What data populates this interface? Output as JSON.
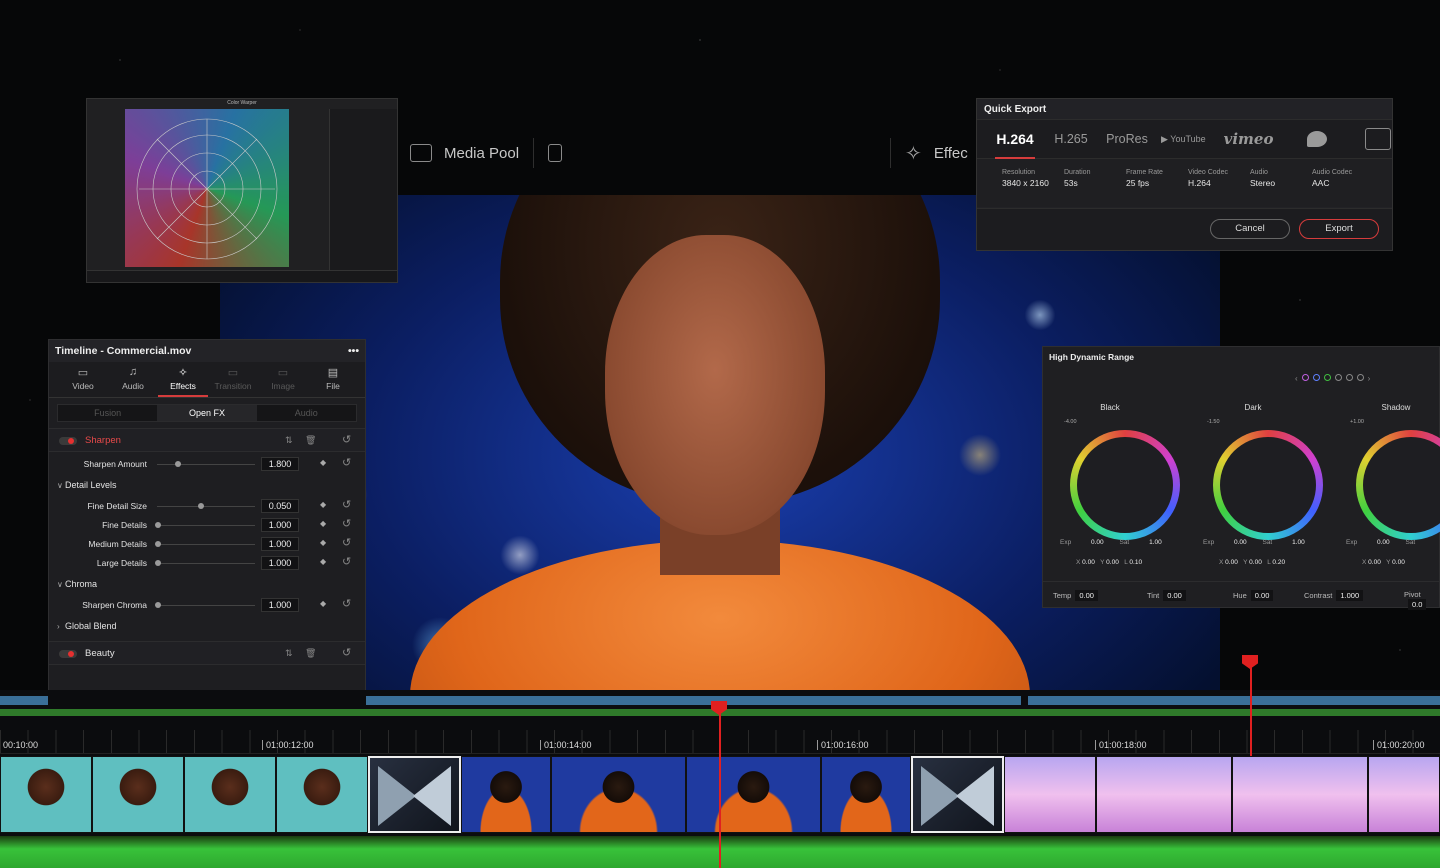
{
  "viewer_strip": {
    "media_pool_label": "Media Pool",
    "effects_label": "Effec"
  },
  "color_warper": {
    "title": "Color Warper"
  },
  "quick_export": {
    "title": "Quick Export",
    "tabs": [
      "H.264",
      "H.265",
      "ProRes"
    ],
    "active_tab": "H.264",
    "youtube_label": "YouTube",
    "vimeo_label": "vimeo",
    "info": [
      {
        "label": "Resolution",
        "value": "3840 x 2160"
      },
      {
        "label": "Duration",
        "value": "53s"
      },
      {
        "label": "Frame Rate",
        "value": "25 fps"
      },
      {
        "label": "Video Codec",
        "value": "H.264"
      },
      {
        "label": "Audio",
        "value": "Stereo"
      },
      {
        "label": "Audio Codec",
        "value": "AAC"
      }
    ],
    "cancel_label": "Cancel",
    "export_label": "Export",
    "accent": "#d63c3c"
  },
  "effects_panel": {
    "title": "Timeline - Commercial.mov",
    "menu_label": "•••",
    "tabs": [
      {
        "label": "Video",
        "icon": "video-icon"
      },
      {
        "label": "Audio",
        "icon": "music-note-icon"
      },
      {
        "label": "Effects",
        "icon": "magic-wand-icon"
      },
      {
        "label": "Transition",
        "icon": "transition-icon"
      },
      {
        "label": "Image",
        "icon": "image-icon"
      },
      {
        "label": "File",
        "icon": "file-icon"
      }
    ],
    "subtabs": [
      "Fusion",
      "Open FX",
      "Audio"
    ],
    "sharpen": {
      "title": "Sharpen",
      "amount_label": "Sharpen Amount",
      "amount_value": "1.800",
      "amount_level": 0.2,
      "detail_levels_label": "Detail Levels",
      "fine_detail_size_label": "Fine Detail Size",
      "fine_detail_size_value": "0.050",
      "fine_detail_size_level": 0.45,
      "fine_details_label": "Fine Details",
      "fine_details_value": "1.000",
      "medium_details_label": "Medium Details",
      "medium_details_value": "1.000",
      "large_details_label": "Large Details",
      "large_details_value": "1.000",
      "chroma_label": "Chroma",
      "sharpen_chroma_label": "Sharpen Chroma",
      "sharpen_chroma_value": "1.000",
      "global_blend_label": "Global Blend"
    },
    "beauty": {
      "title": "Beauty"
    }
  },
  "hdr_panel": {
    "title": "High Dynamic Range",
    "wheels": [
      {
        "name": "Black",
        "num": "-4.00",
        "exp": "0.00",
        "sat": "1.00",
        "x": "0.00",
        "y": "0.00",
        "l": "0.10"
      },
      {
        "name": "Dark",
        "num": "-1.50",
        "exp": "0.00",
        "sat": "1.00",
        "x": "0.00",
        "y": "0.00",
        "l": "0.20"
      },
      {
        "name": "Shadow",
        "num": "+1.00",
        "exp": "0.00",
        "sat": "",
        "x": "0.00",
        "y": "0.00",
        "l": ""
      }
    ],
    "labels": {
      "exp": "Exp",
      "sat": "Sat",
      "x": "X",
      "y": "Y",
      "l": "L"
    },
    "bottom": {
      "temp_label": "Temp",
      "temp_value": "0.00",
      "tint_label": "Tint",
      "tint_value": "0.00",
      "hue_label": "Hue",
      "hue_value": "0.00",
      "contrast_label": "Contrast",
      "contrast_value": "1.000",
      "pivot_label": "Pivot",
      "pivot_value": "0.0"
    }
  },
  "timeline": {
    "timecodes": [
      "00:10:00",
      "01:00:12:00",
      "01:00:14:00",
      "01:00:16:00",
      "01:00:18:00",
      "01:00:20:00"
    ],
    "playhead_color": "#e02020"
  }
}
